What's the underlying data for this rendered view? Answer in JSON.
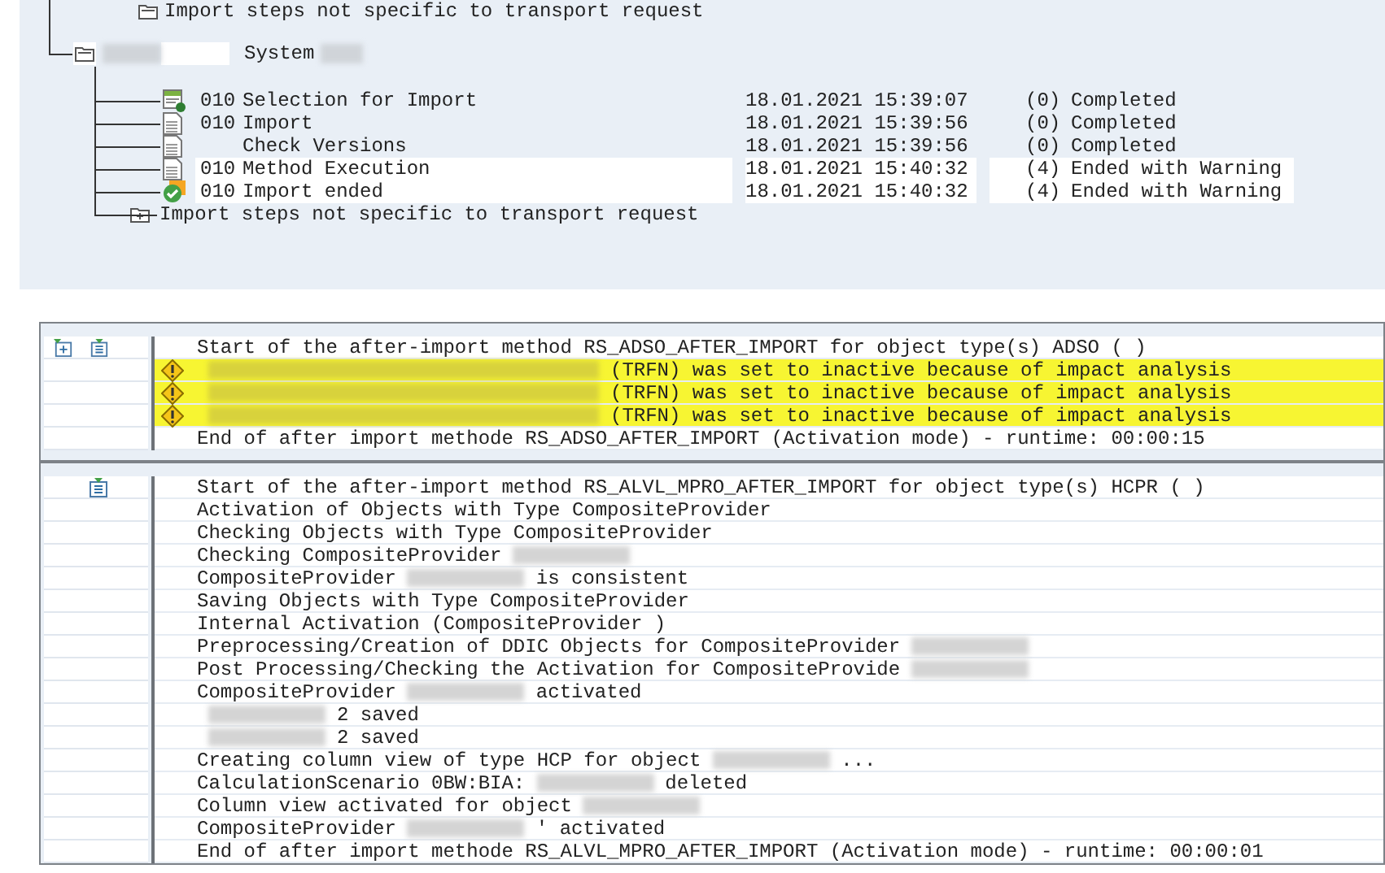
{
  "tree": {
    "cut_row": "Import steps not specific to transport request",
    "system": {
      "label": "System"
    },
    "steps": [
      {
        "kind": "selection",
        "number": "010",
        "name": "Selection for Import",
        "date": "18.01.2021 15:39:07",
        "code": "(0)",
        "status": "Completed",
        "highlighted": false
      },
      {
        "kind": "document",
        "number": "010",
        "name": "Import",
        "date": "18.01.2021 15:39:56",
        "code": "(0)",
        "status": "Completed",
        "highlighted": false
      },
      {
        "kind": "document",
        "name": "Check Versions",
        "date": "18.01.2021 15:39:56",
        "code": "(0)",
        "status": "Completed",
        "highlighted": false
      },
      {
        "kind": "document",
        "number": "010",
        "name": "Method Execution",
        "date": "18.01.2021 15:40:32",
        "code": "(4)",
        "status": "Ended with Warning",
        "highlighted": true
      },
      {
        "kind": "done",
        "number": "010",
        "name": "Import ended",
        "date": "18.01.2021 15:40:32",
        "code": "(4)",
        "status": "Ended with Warning",
        "highlighted": true
      }
    ],
    "footer_node": "Import steps not specific to transport request"
  },
  "log": [
    {
      "buttons": [
        {
          "kind": "expand"
        },
        {
          "kind": "collapse"
        }
      ],
      "entries": [
        {
          "kind": "info",
          "segments": [
            {
              "kind": "text",
              "text": "Start of the after-import method RS_ADSO_AFTER_IMPORT for object type(s) ADSO ( )"
            }
          ]
        },
        {
          "kind": "warning",
          "segments": [
            {
              "kind": "redacted"
            },
            {
              "kind": "text",
              "text": "(TRFN) was set to inactive because of impact analysis"
            }
          ]
        },
        {
          "kind": "warning",
          "segments": [
            {
              "kind": "redacted"
            },
            {
              "kind": "text",
              "text": "(TRFN) was set to inactive because of impact analysis"
            }
          ]
        },
        {
          "kind": "warning",
          "segments": [
            {
              "kind": "redacted"
            },
            {
              "kind": "text",
              "text": "(TRFN) was set to inactive because of impact analysis"
            }
          ]
        },
        {
          "kind": "info",
          "segments": [
            {
              "kind": "text",
              "text": "End of after import methode RS_ADSO_AFTER_IMPORT (Activation mode) - runtime: 00:00:15"
            }
          ]
        }
      ]
    },
    {
      "buttons": [
        {
          "kind": "collapse"
        }
      ],
      "entries": [
        {
          "kind": "info",
          "segments": [
            {
              "kind": "text",
              "text": "Start of the after-import method RS_ALVL_MPRO_AFTER_IMPORT for object type(s) HCPR ( )"
            }
          ]
        },
        {
          "kind": "info",
          "segments": [
            {
              "kind": "text",
              "text": "Activation of Objects with Type CompositeProvider"
            }
          ]
        },
        {
          "kind": "info",
          "segments": [
            {
              "kind": "text",
              "text": "Checking Objects with Type CompositeProvider"
            }
          ]
        },
        {
          "kind": "info",
          "segments": [
            {
              "kind": "text",
              "text": "Checking CompositeProvider"
            },
            {
              "kind": "redacted"
            }
          ]
        },
        {
          "kind": "info",
          "segments": [
            {
              "kind": "text",
              "text": "CompositeProvider"
            },
            {
              "kind": "redacted"
            },
            {
              "kind": "text",
              "text": "is consistent"
            }
          ]
        },
        {
          "kind": "info",
          "segments": [
            {
              "kind": "text",
              "text": "Saving Objects with Type CompositeProvider"
            }
          ]
        },
        {
          "kind": "info",
          "segments": [
            {
              "kind": "text",
              "text": "Internal Activation (CompositeProvider )"
            }
          ]
        },
        {
          "kind": "info",
          "segments": [
            {
              "kind": "text",
              "text": "Preprocessing/Creation of DDIC Objects for CompositeProvider"
            },
            {
              "kind": "redacted"
            }
          ]
        },
        {
          "kind": "info",
          "segments": [
            {
              "kind": "text",
              "text": "Post Processing/Checking the Activation for CompositeProvide"
            },
            {
              "kind": "redacted"
            }
          ]
        },
        {
          "kind": "info",
          "segments": [
            {
              "kind": "text",
              "text": "CompositeProvider"
            },
            {
              "kind": "redacted"
            },
            {
              "kind": "text",
              "text": "activated"
            }
          ]
        },
        {
          "kind": "info",
          "segments": [
            {
              "kind": "redacted"
            },
            {
              "kind": "text",
              "text": "2 saved"
            }
          ]
        },
        {
          "kind": "info",
          "segments": [
            {
              "kind": "redacted"
            },
            {
              "kind": "text",
              "text": "2 saved"
            }
          ]
        },
        {
          "kind": "info",
          "segments": [
            {
              "kind": "text",
              "text": "Creating column view of type HCP for object"
            },
            {
              "kind": "redacted"
            },
            {
              "kind": "text",
              "text": "..."
            }
          ]
        },
        {
          "kind": "info",
          "segments": [
            {
              "kind": "text",
              "text": "CalculationScenario 0BW:BIA:"
            },
            {
              "kind": "redacted"
            },
            {
              "kind": "text",
              "text": "deleted"
            }
          ]
        },
        {
          "kind": "info",
          "segments": [
            {
              "kind": "text",
              "text": "Column view activated for object"
            },
            {
              "kind": "redacted"
            }
          ]
        },
        {
          "kind": "info",
          "segments": [
            {
              "kind": "text",
              "text": "CompositeProvider"
            },
            {
              "kind": "redacted"
            },
            {
              "kind": "text",
              "text": "' activated"
            }
          ]
        },
        {
          "kind": "info",
          "segments": [
            {
              "kind": "text",
              "text": "End of after import methode RS_ALVL_MPRO_AFTER_IMPORT (Activation mode) - runtime: 00:00:01"
            }
          ]
        }
      ]
    }
  ]
}
